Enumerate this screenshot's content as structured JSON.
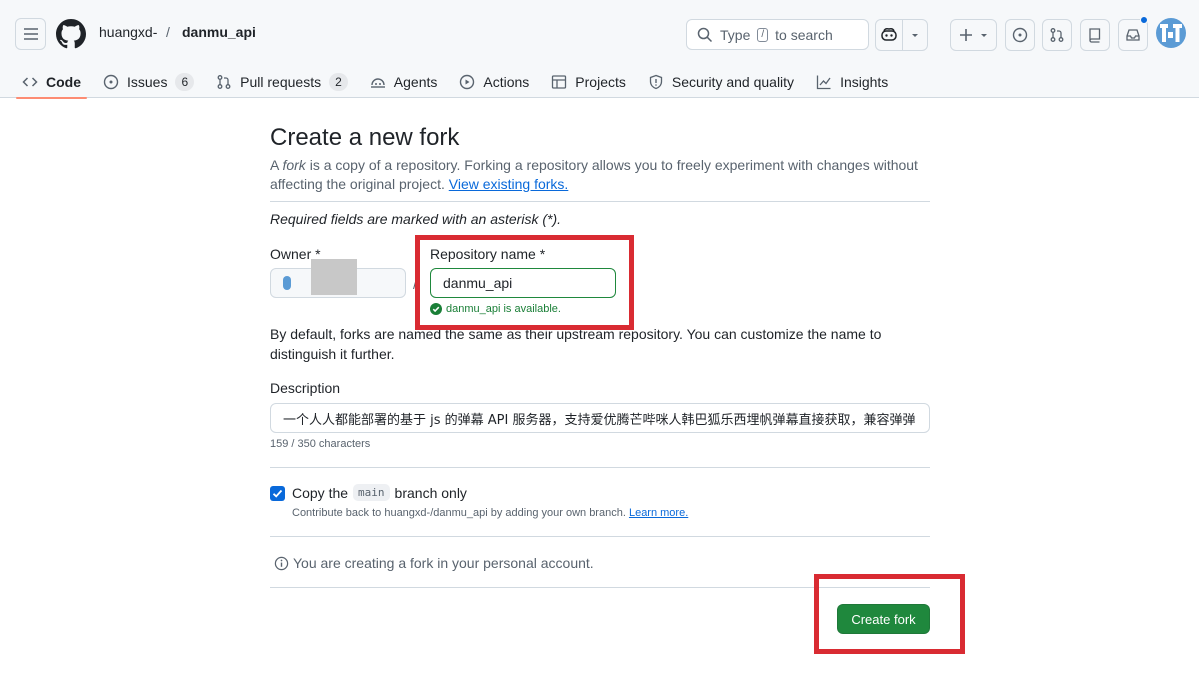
{
  "header": {
    "owner": "huangxd-",
    "separator": "/",
    "repo": "danmu_api",
    "search_prefix": "Type",
    "search_key": "/",
    "search_suffix": "to search"
  },
  "tabs": [
    {
      "label": "Code",
      "icon": "code-icon"
    },
    {
      "label": "Issues",
      "count": "6",
      "icon": "issue-icon"
    },
    {
      "label": "Pull requests",
      "count": "2",
      "icon": "pull-request-icon"
    },
    {
      "label": "Agents",
      "icon": "agents-icon"
    },
    {
      "label": "Actions",
      "icon": "play-icon"
    },
    {
      "label": "Projects",
      "icon": "table-icon"
    },
    {
      "label": "Security and quality",
      "icon": "shield-icon"
    },
    {
      "label": "Insights",
      "icon": "graph-icon"
    }
  ],
  "page": {
    "title": "Create a new fork",
    "intro_a": "A ",
    "intro_fork": "fork",
    "intro_b": " is a copy of a repository. Forking a repository allows you to freely experiment with changes without affecting the original project. ",
    "intro_link": "View existing forks.",
    "required_note": "Required fields are marked with an asterisk (*).",
    "owner_label": "Owner *",
    "repo_label": "Repository name *",
    "repo_value": "danmu_api",
    "availability": "danmu_api is available.",
    "name_help": "By default, forks are named the same as their upstream repository. You can customize the name to distinguish it further.",
    "description_label": "Description",
    "description_value": "一个人人都能部署的基于 js 的弹幕 API 服务器，支持爱优腾芒哔咪人韩巴狐乐西埋帆弹幕直接获取，兼容弹弹",
    "char_count": "159 / 350 characters",
    "copy_a": "Copy the",
    "copy_branch": "main",
    "copy_b": "branch only",
    "copy_help": "Contribute back to huangxd-/danmu_api by adding your own branch.",
    "learn_more": "Learn more.",
    "account_note": "You are creating a fork in your personal account.",
    "create_button": "Create fork"
  },
  "colors": {
    "accent_green": "#1f883d",
    "link_blue": "#0969da",
    "highlight_red": "#d92b32",
    "tab_underline": "#fd8c73"
  }
}
